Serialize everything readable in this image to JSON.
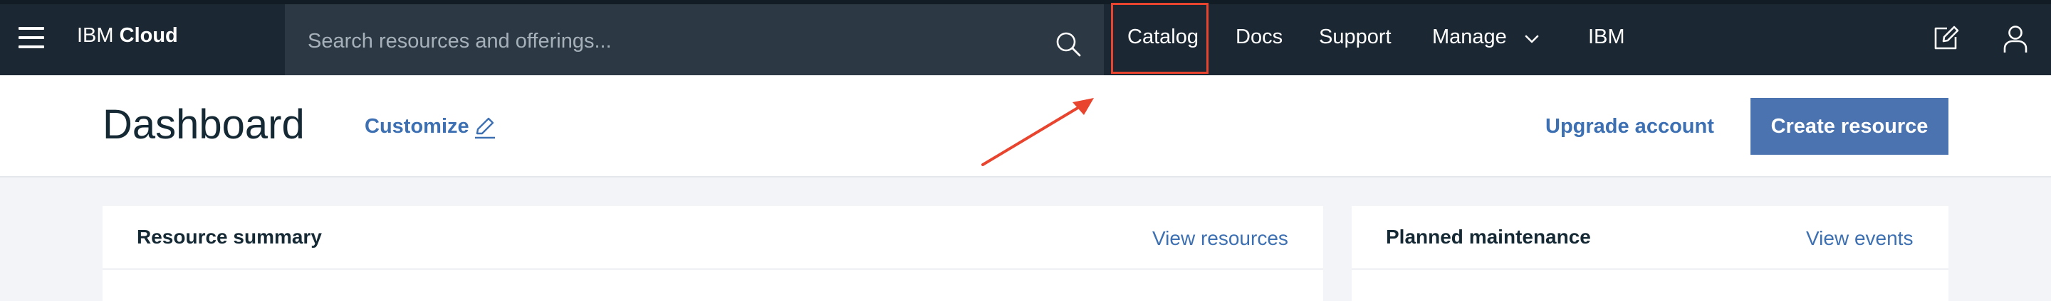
{
  "topbar": {
    "brand_prefix": "IBM",
    "brand_name": "Cloud",
    "search_placeholder": "Search resources and offerings...",
    "nav": {
      "catalog": "Catalog",
      "docs": "Docs",
      "support": "Support",
      "manage": "Manage",
      "ibm": "IBM"
    },
    "icons": [
      "menu-icon",
      "search-icon",
      "chevron-down-icon",
      "edit-icon",
      "user-icon"
    ]
  },
  "header": {
    "title": "Dashboard",
    "customize_label": "Customize",
    "upgrade_label": "Upgrade account",
    "create_label": "Create resource"
  },
  "cards": {
    "resource_summary": {
      "title": "Resource summary",
      "link": "View resources"
    },
    "planned_maintenance": {
      "title": "Planned maintenance",
      "link": "View events"
    }
  },
  "colors": {
    "topbar_bg": "#1b2834",
    "search_bg": "#2c3944",
    "accent_link": "#3d70b2",
    "primary_button": "#4a73b0",
    "highlight_box": "#e8442e",
    "page_bg": "#f2f4f8"
  }
}
